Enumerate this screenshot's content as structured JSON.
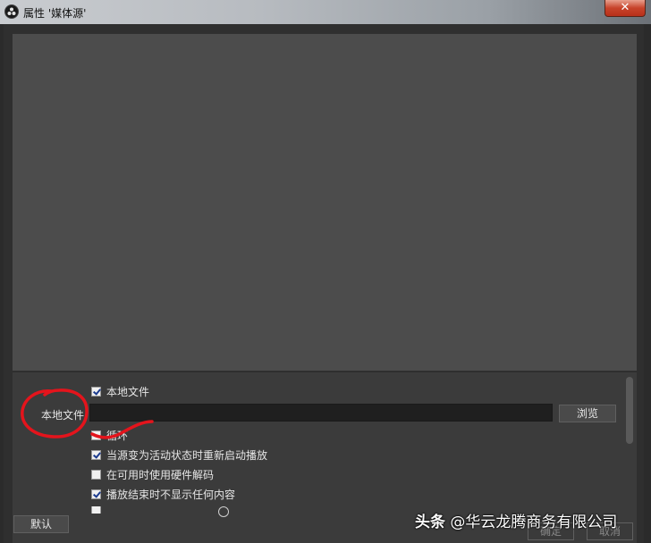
{
  "window": {
    "title": "属性 '媒体源'",
    "close_label": "✕",
    "accent": "#c7432a"
  },
  "properties": {
    "local_file_checkbox": {
      "label": "本地文件",
      "checked": true
    },
    "file_field": {
      "label": "本地文件",
      "value": ""
    },
    "browse_label": "浏览",
    "options": [
      {
        "label": "循环",
        "checked": false
      },
      {
        "label": "当源变为活动状态时重新启动播放",
        "checked": true
      },
      {
        "label": "在可用时使用硬件解码",
        "checked": false
      },
      {
        "label": "播放结束时不显示任何内容",
        "checked": true
      }
    ]
  },
  "footer": {
    "default_label": "默认",
    "ok_label": "确定",
    "cancel_label": "取消"
  },
  "watermark": {
    "source": "头条",
    "handle": "@华云龙腾商务有限公司"
  }
}
